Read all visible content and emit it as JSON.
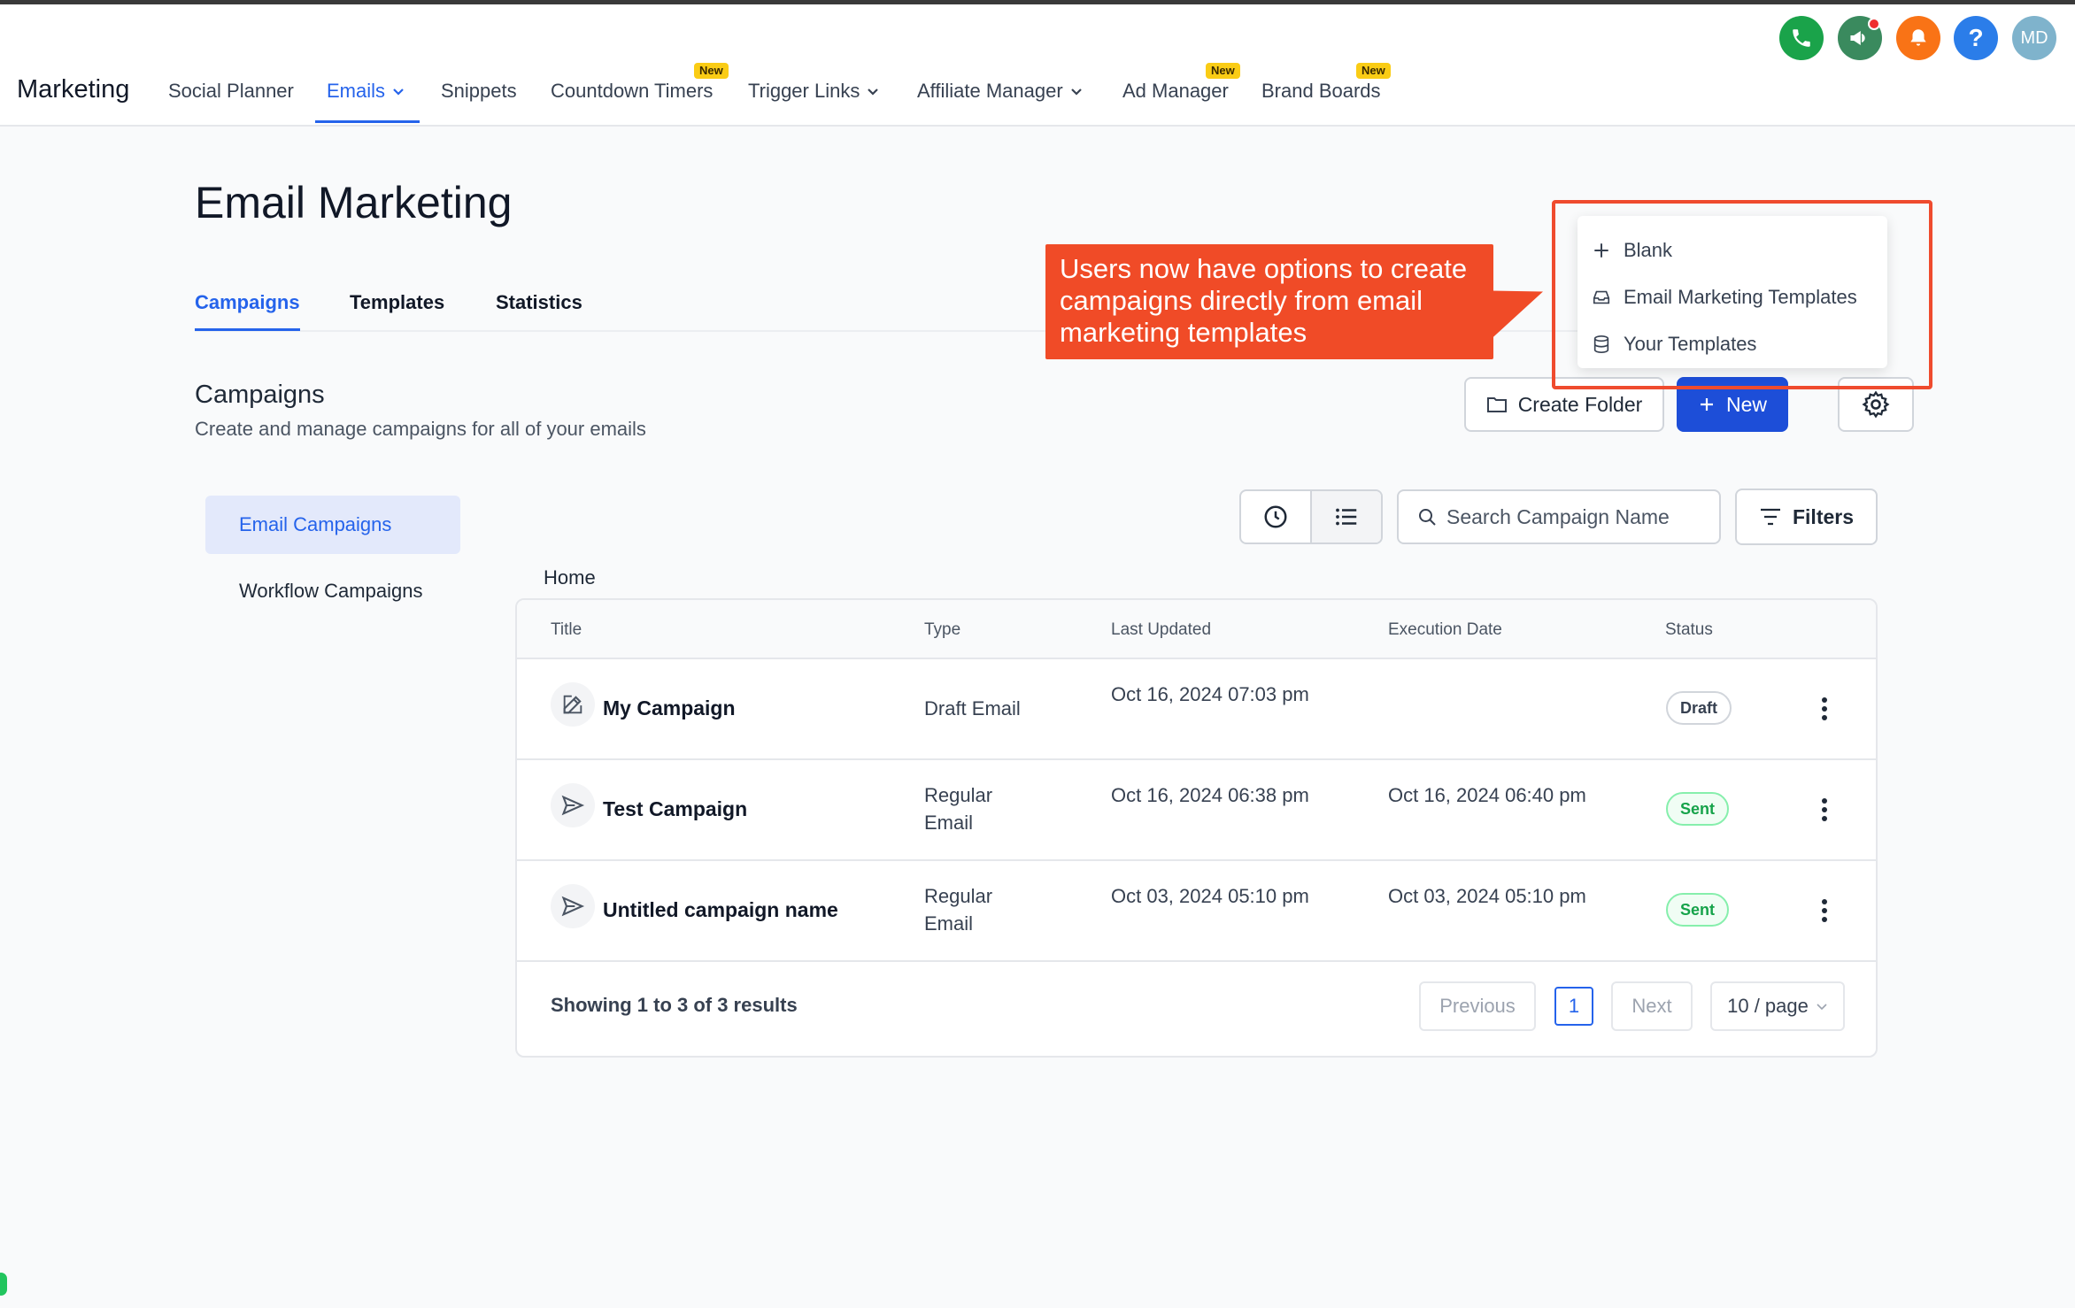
{
  "app": {
    "brand": "Marketing"
  },
  "nav": {
    "items": [
      {
        "label": "Social Planner"
      },
      {
        "label": "Emails"
      },
      {
        "label": "Snippets"
      },
      {
        "label": "Countdown Timers"
      },
      {
        "label": "Trigger Links"
      },
      {
        "label": "Affiliate Manager"
      },
      {
        "label": "Ad Manager"
      },
      {
        "label": "Brand Boards"
      }
    ],
    "new_badge": "New"
  },
  "header_icons": {
    "avatar_initials": "MD",
    "help": "?",
    "colors": {
      "phone": "#1aa34a",
      "megaphone": "#3a8a5e",
      "bell": "#f97316",
      "help": "#2b7de9",
      "avatar": "#7fb3cc"
    }
  },
  "page": {
    "title": "Email Marketing",
    "tabs": [
      {
        "label": "Campaigns"
      },
      {
        "label": "Templates"
      },
      {
        "label": "Statistics"
      }
    ]
  },
  "section": {
    "title": "Campaigns",
    "subtitle": "Create and manage campaigns for all of your emails"
  },
  "actions": {
    "create_folder": "Create Folder",
    "new": "New"
  },
  "dropdown": {
    "items": [
      {
        "label": "Blank",
        "icon": "plus-icon"
      },
      {
        "label": "Email Marketing Templates",
        "icon": "inbox-icon"
      },
      {
        "label": "Your Templates",
        "icon": "database-icon"
      }
    ]
  },
  "callout": {
    "text": "Users now have options to create campaigns directly from email marketing templates"
  },
  "sidebar": {
    "items": [
      {
        "label": "Email Campaigns"
      },
      {
        "label": "Workflow Campaigns"
      }
    ]
  },
  "toolbar": {
    "search_placeholder": "Search Campaign Name",
    "filters": "Filters"
  },
  "breadcrumb": "Home",
  "table": {
    "columns": [
      "Title",
      "Type",
      "Last Updated",
      "Execution Date",
      "Status"
    ],
    "rows": [
      {
        "title": "My Campaign",
        "type": "Draft Email",
        "last_updated": "Oct 16, 2024 07:03 pm",
        "execution_date": "",
        "status": "Draft",
        "icon": "edit-icon"
      },
      {
        "title": "Test Campaign",
        "type": "Regular Email",
        "last_updated": "Oct 16, 2024 06:38 pm",
        "execution_date": "Oct 16, 2024 06:40 pm",
        "status": "Sent",
        "icon": "send-icon"
      },
      {
        "title": "Untitled campaign name",
        "type": "Regular Email",
        "last_updated": "Oct 03, 2024 05:10 pm",
        "execution_date": "Oct 03, 2024 05:10 pm",
        "status": "Sent",
        "icon": "send-icon"
      }
    ]
  },
  "pagination": {
    "summary": "Showing 1 to 3 of 3 results",
    "previous": "Previous",
    "current": "1",
    "next": "Next",
    "page_size": "10 / page"
  }
}
